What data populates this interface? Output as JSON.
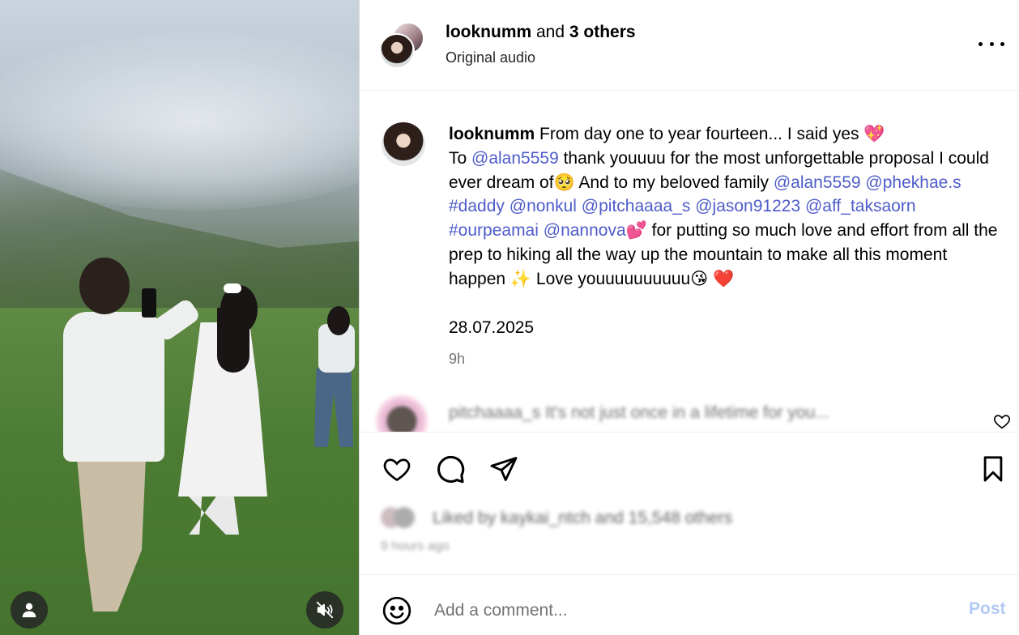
{
  "header": {
    "username": "looknumm",
    "and_text": " and ",
    "others_text": "3 others",
    "subtitle": "Original audio",
    "more_icon": "more-horizontal-icon"
  },
  "caption": {
    "username": "looknumm",
    "text_1": " From day one to year fourteen... I said yes 💖",
    "text_2": "To ",
    "mention_1": "@alan5559",
    "text_3": " thank youuuu for the most unforgettable proposal I could ever dream of🥺  And to my beloved family ",
    "mention_2": "@alan5559",
    "mention_3": "@phekhae.s",
    "hashtag_1": "#daddy",
    "mention_4": "@nonkul",
    "mention_5": "@pitchaaaa_s",
    "mention_6": "@jason91223",
    "mention_7": "@aff_taksaorn",
    "hashtag_2": "#ourpeamai",
    "mention_8": "@nannova",
    "text_4": "💕  for putting so much love and effort from all the prep to hiking all the way up the mountain to make all this moment happen ✨  Love youuuuuuuuuu😘 ❤️",
    "date": "28.07.2025",
    "age": "9h"
  },
  "comment_preview": {
    "text": "pitchaaaa_s It's not just once in a lifetime for you..."
  },
  "likes": {
    "text": "Liked by kaykai_ntch and 15,548 others",
    "time_ago": "9 hours ago"
  },
  "composer": {
    "placeholder": "Add a comment...",
    "post_label": "Post"
  },
  "colors": {
    "link": "#4e5cc9",
    "post_disabled": "#b3c9f5",
    "muted_text": "#737373",
    "border": "#efefef"
  }
}
